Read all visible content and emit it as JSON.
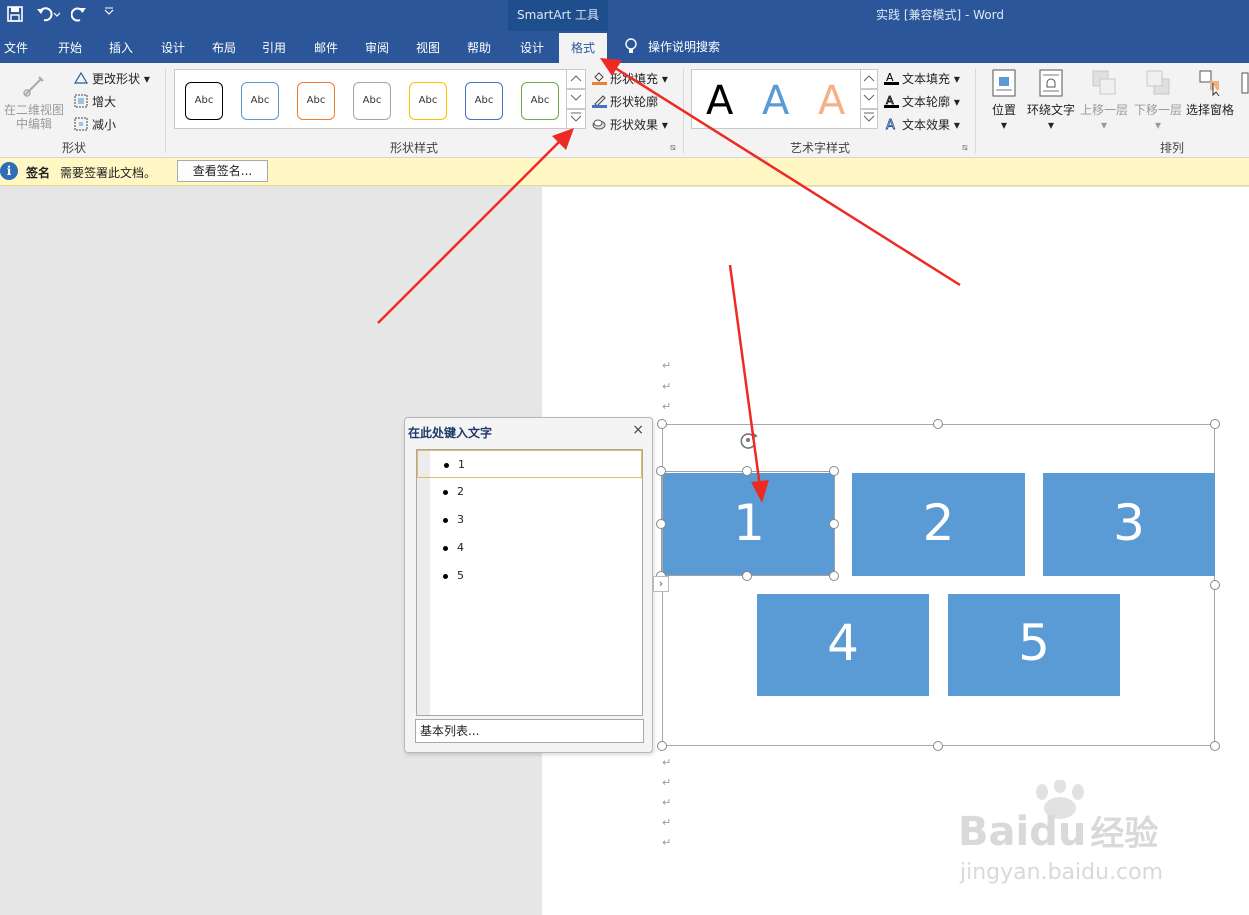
{
  "titlebar": {
    "context_title": "SmartArt 工具",
    "doc_title": "实践 [兼容模式]  -  Word",
    "qat": [
      "save-icon",
      "undo-icon",
      "redo-icon",
      "customize-qat-icon"
    ]
  },
  "tabs": [
    "文件",
    "开始",
    "插入",
    "设计",
    "布局",
    "引用",
    "邮件",
    "审阅",
    "视图",
    "帮助",
    "设计",
    "格式"
  ],
  "active_tab": "格式",
  "search_tab": "操作说明搜索",
  "ribbon": {
    "shapes_group": {
      "edit_2d": "在二维视图中编辑",
      "change_shape": "更改形状",
      "larger": "增大",
      "smaller": "减小",
      "label": "形状"
    },
    "shape_styles": {
      "swatch_text": "Abc",
      "swatch_colors": [
        "#000000",
        "#5b9bd5",
        "#ed7d31",
        "#a5a5a5",
        "#ffc000",
        "#4472c4",
        "#70ad47"
      ],
      "fill": "形状填充",
      "outline": "形状轮廓",
      "effects": "形状效果",
      "label": "形状样式"
    },
    "wordart": {
      "letter": "A",
      "text_fill": "文本填充",
      "text_outline": "文本轮廓",
      "text_effects": "文本效果",
      "label": "艺术字样式"
    },
    "arrange": {
      "position": "位置",
      "wrap_text": "环绕文字",
      "bring_forward": "上移一层",
      "send_backward": "下移一层",
      "selection_pane": "选择窗格",
      "label": "排列"
    }
  },
  "notice": {
    "label": "签名",
    "message": "需要签署此文档。",
    "button": "查看签名..."
  },
  "smartart": {
    "items": [
      "1",
      "2",
      "3",
      "4",
      "5"
    ],
    "fill_color": "#5b9bd5"
  },
  "text_pane": {
    "title": "在此处键入文字",
    "close": "×",
    "items": [
      "1",
      "2",
      "3",
      "4",
      "5"
    ],
    "footer": "基本列表..."
  },
  "paragraph_mark": "↵",
  "watermark": {
    "brand": "Bai",
    "brand_tail": "du",
    "brand_cn": "经验",
    "url": "jingyan.baidu.com"
  }
}
